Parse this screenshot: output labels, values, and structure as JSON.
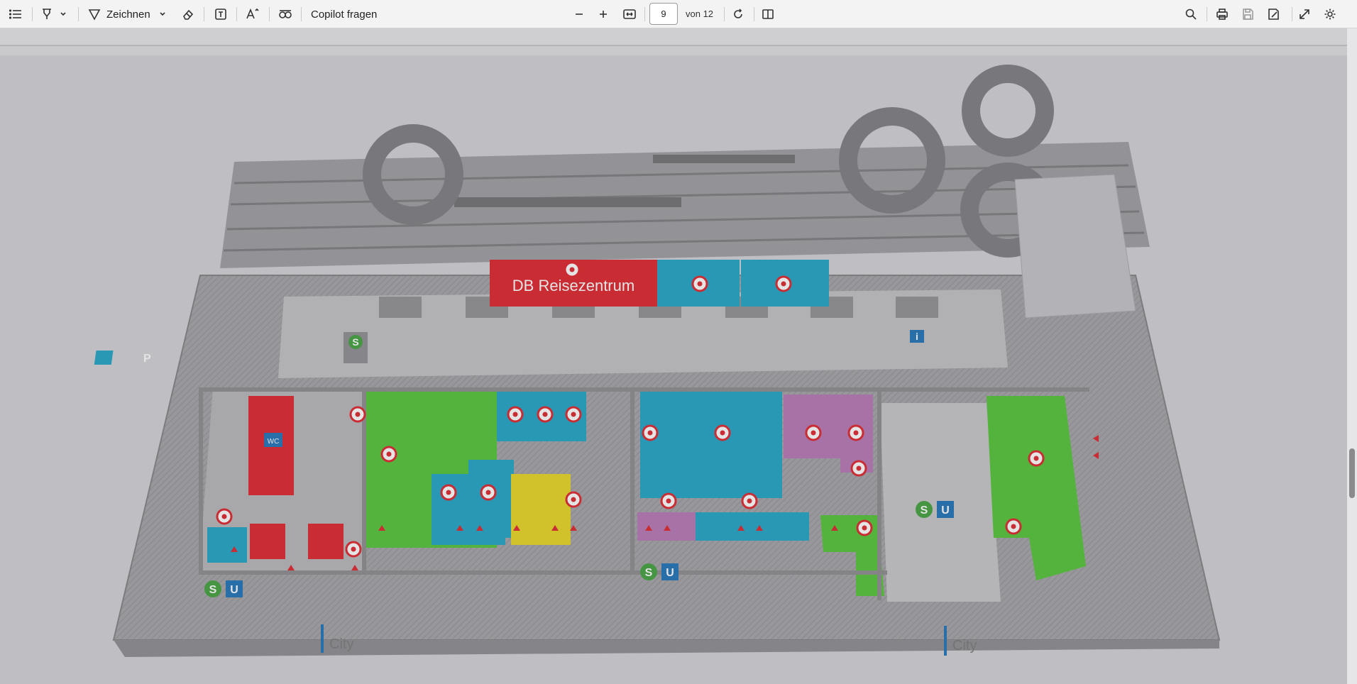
{
  "toolbar": {
    "draw_label": "Zeichnen",
    "copilot_label": "Copilot fragen",
    "page_current": "9",
    "page_total_label": "von 12"
  },
  "map": {
    "reisezentrum_label": "DB Reisezentrum",
    "wc_label": "WC",
    "parking_label": "P",
    "info_label": "i",
    "sbahn_label": "S",
    "ubahn_label": "U",
    "city_label_left": "City",
    "city_label_right": "City"
  },
  "colors": {
    "red": "#e01f26",
    "blue": "#1aa3c4",
    "green": "#4fc431",
    "purple": "#b574b3",
    "yellow": "#e8d51c",
    "floor": "#9b9b9d",
    "wall": "#8a8a8c"
  }
}
